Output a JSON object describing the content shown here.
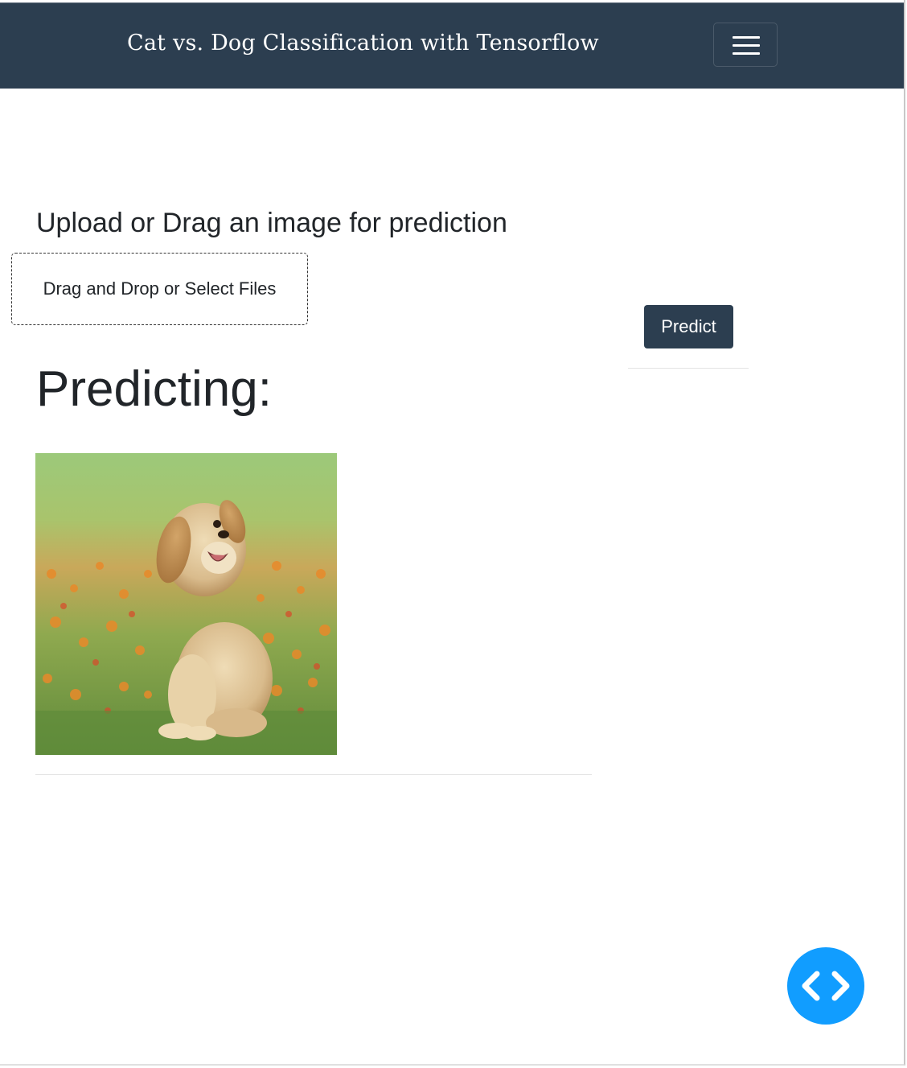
{
  "navbar": {
    "brand": "Cat vs. Dog Classification with Tensorflow",
    "toggler_icon": "hamburger-menu-icon",
    "background": "#2c3e50"
  },
  "upload": {
    "heading": "Upload or Drag an image for prediction",
    "dropzone_label": "Drag and Drop or Select Files"
  },
  "actions": {
    "predict_label": "Predict"
  },
  "result": {
    "heading": "Predicting:"
  },
  "fab": {
    "icon": "code-brackets-icon",
    "color": "#119dff"
  }
}
